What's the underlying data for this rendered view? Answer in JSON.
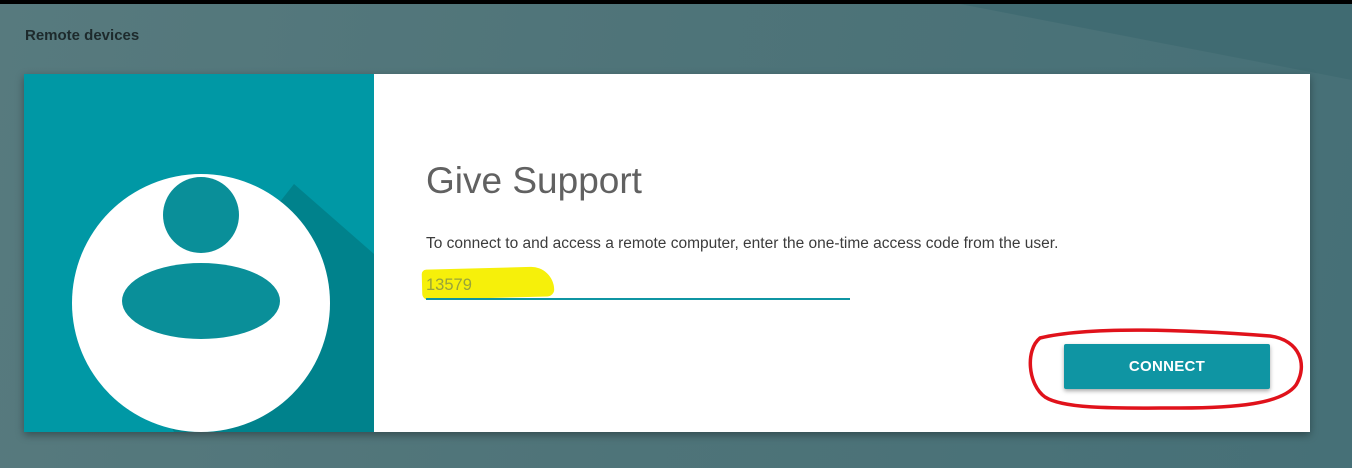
{
  "header": {
    "section_title": "Remote devices"
  },
  "support_card": {
    "title": "Give Support",
    "description": "To connect to and access a remote computer, enter the one-time access code from the user.",
    "access_code_value": "13579",
    "connect_label": "CONNECT"
  },
  "icons": {
    "hero": "person-icon"
  },
  "colors": {
    "accent": "#0f95a3",
    "hero_background": "#0098a5",
    "highlight": "#f6f00a",
    "annotation": "#e0121b"
  }
}
